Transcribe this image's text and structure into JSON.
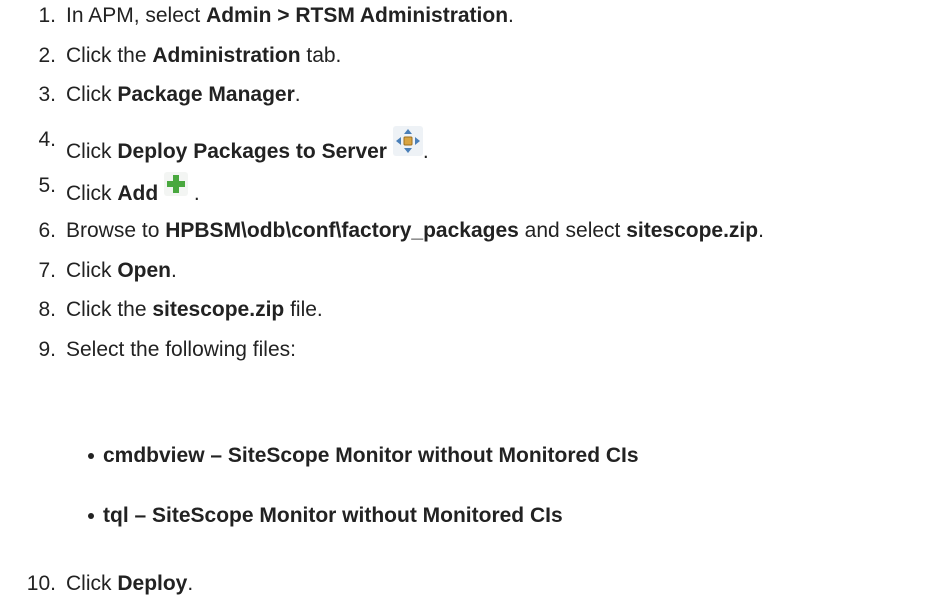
{
  "steps": [
    {
      "num": "1.",
      "parts": [
        {
          "t": "In APM, select "
        },
        {
          "t": "Admin > RTSM Administration",
          "b": true
        },
        {
          "t": "."
        }
      ]
    },
    {
      "num": "2.",
      "parts": [
        {
          "t": "Click the "
        },
        {
          "t": "Administration",
          "b": true
        },
        {
          "t": " tab."
        }
      ]
    },
    {
      "num": "3.",
      "parts": [
        {
          "t": "Click "
        },
        {
          "t": "Package Manager",
          "b": true
        },
        {
          "t": "."
        }
      ]
    },
    {
      "num": "4.",
      "parts": [
        {
          "t": "Click "
        },
        {
          "t": "Deploy Packages to Server",
          "b": true
        },
        {
          "t": " "
        },
        {
          "icon": "deploy-packages-icon"
        },
        {
          "t": "."
        }
      ]
    },
    {
      "num": "5.",
      "parts": [
        {
          "t": "Click "
        },
        {
          "t": "Add",
          "b": true
        },
        {
          "t": " "
        },
        {
          "icon": "add-plus-icon"
        },
        {
          "t": " ."
        }
      ]
    },
    {
      "num": "6.",
      "parts": [
        {
          "t": "Browse to "
        },
        {
          "t": "HPBSM\\odb\\conf\\factory_packages",
          "b": true
        },
        {
          "t": " and select "
        },
        {
          "t": "sitescope.zip",
          "b": true
        },
        {
          "t": "."
        }
      ]
    },
    {
      "num": "7.",
      "parts": [
        {
          "t": "Click "
        },
        {
          "t": "Open",
          "b": true
        },
        {
          "t": "."
        }
      ]
    },
    {
      "num": "8.",
      "parts": [
        {
          "t": "Click the "
        },
        {
          "t": "sitescope.zip",
          "b": true
        },
        {
          "t": " file."
        }
      ]
    },
    {
      "num": "9.",
      "parts": [
        {
          "t": "Select the following files:"
        }
      ]
    },
    {
      "num": "10.",
      "parts": [
        {
          "t": "Click "
        },
        {
          "t": "Deploy",
          "b": true
        },
        {
          "t": "."
        }
      ]
    }
  ],
  "subitems": [
    "cmdbview – SiteScope Monitor without Monitored CIs",
    "tql – SiteScope Monitor without Monitored CIs"
  ]
}
